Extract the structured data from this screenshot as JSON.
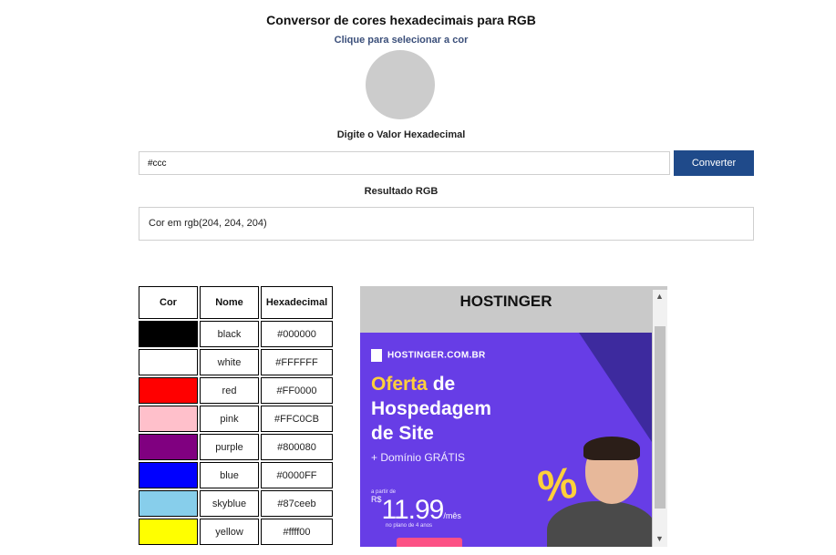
{
  "page": {
    "title": "Conversor de cores hexadecimais para RGB",
    "picker_hint": "Clique para selecionar a cor",
    "swatch_color": "#cccccc",
    "hex_label": "Digite o Valor Hexadecimal",
    "hex_value": "#ccc",
    "convert_button": "Converter",
    "result_label": "Resultado RGB",
    "result_text": "Cor em rgb(204, 204, 204)"
  },
  "color_table": {
    "headers": [
      "Cor",
      "Nome",
      "Hexadecimal"
    ],
    "rows": [
      {
        "swatch": "#000000",
        "name": "black",
        "hex": "#000000"
      },
      {
        "swatch": "#ffffff",
        "name": "white",
        "hex": "#FFFFFF"
      },
      {
        "swatch": "#ff0000",
        "name": "red",
        "hex": "#FF0000"
      },
      {
        "swatch": "#ffc0cb",
        "name": "pink",
        "hex": "#FFC0CB"
      },
      {
        "swatch": "#800080",
        "name": "purple",
        "hex": "#800080"
      },
      {
        "swatch": "#0000ff",
        "name": "blue",
        "hex": "#0000FF"
      },
      {
        "swatch": "#87ceeb",
        "name": "skyblue",
        "hex": "#87ceeb"
      },
      {
        "swatch": "#ffff00",
        "name": "yellow",
        "hex": "#ffff00"
      }
    ]
  },
  "ad": {
    "header": "HOSTINGER",
    "brand": "HOSTINGER.COM.BR",
    "headline_highlight": "Oferta",
    "headline_rest_1": " de",
    "headline_line_2": "Hospedagem",
    "headline_line_3": "de Site",
    "domain_text": "+ Domínio GRÁTIS",
    "price_prefix": "a partir de",
    "currency": "R$",
    "price": "11.99",
    "per": "/mês",
    "price_note": "no plano de 4 anos",
    "percent_symbol": "%",
    "scroll_up": "▲",
    "scroll_down": "▼"
  },
  "colors": {
    "accent_button": "#1f4a8a",
    "ad_purple": "#673de6",
    "ad_yellow": "#ffd03b"
  }
}
